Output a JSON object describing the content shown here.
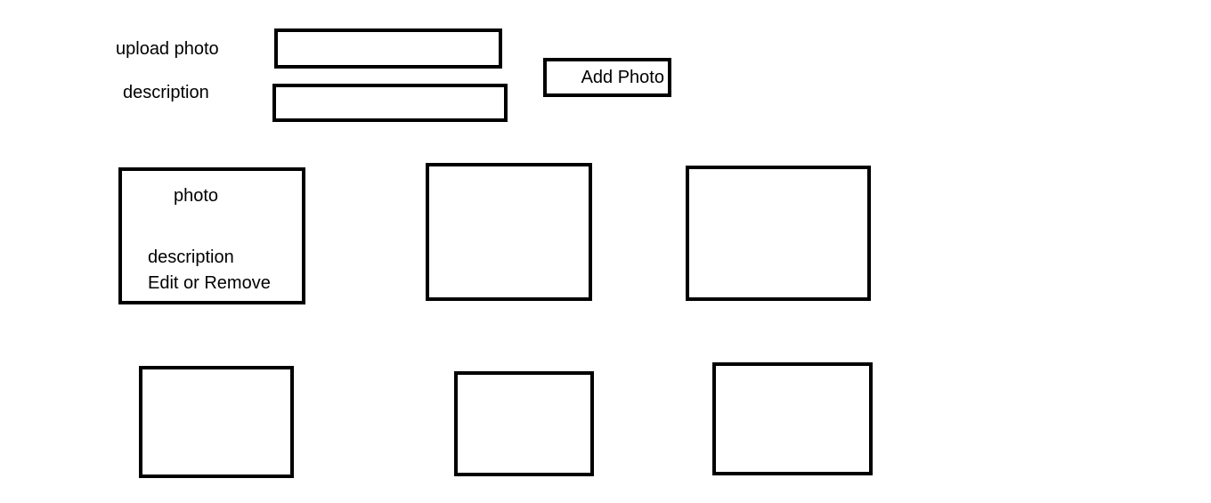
{
  "form": {
    "upload_label": "upload photo",
    "upload_value": "",
    "description_label": "description",
    "description_value": "",
    "add_button_label": "Add Photo"
  },
  "gallery": {
    "first_card": {
      "photo_label": "photo",
      "description_label": "description",
      "actions_label": "Edit or Remove"
    }
  }
}
